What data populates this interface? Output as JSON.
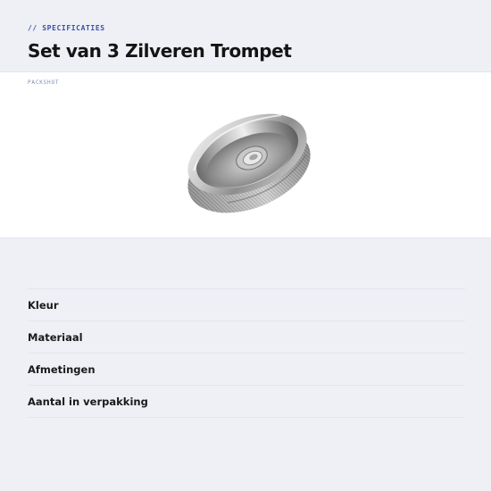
{
  "header": {
    "eyebrow": "// SPECIFICATIES",
    "title": "Set van 3 Zilveren Trompet"
  },
  "packshot": {
    "label": "PACKSHOT",
    "image_subject": "silver trumpet mute cap",
    "icon": "product-image"
  },
  "specs": {
    "rows": [
      {
        "label": "Kleur"
      },
      {
        "label": "Materiaal"
      },
      {
        "label": "Afmetingen"
      },
      {
        "label": "Aantal in verpakking"
      }
    ]
  },
  "colors": {
    "background": "#eef0f5",
    "panel": "#ffffff",
    "accent": "#3a4fa8",
    "text": "#141414",
    "divider": "#e2e5ec"
  }
}
